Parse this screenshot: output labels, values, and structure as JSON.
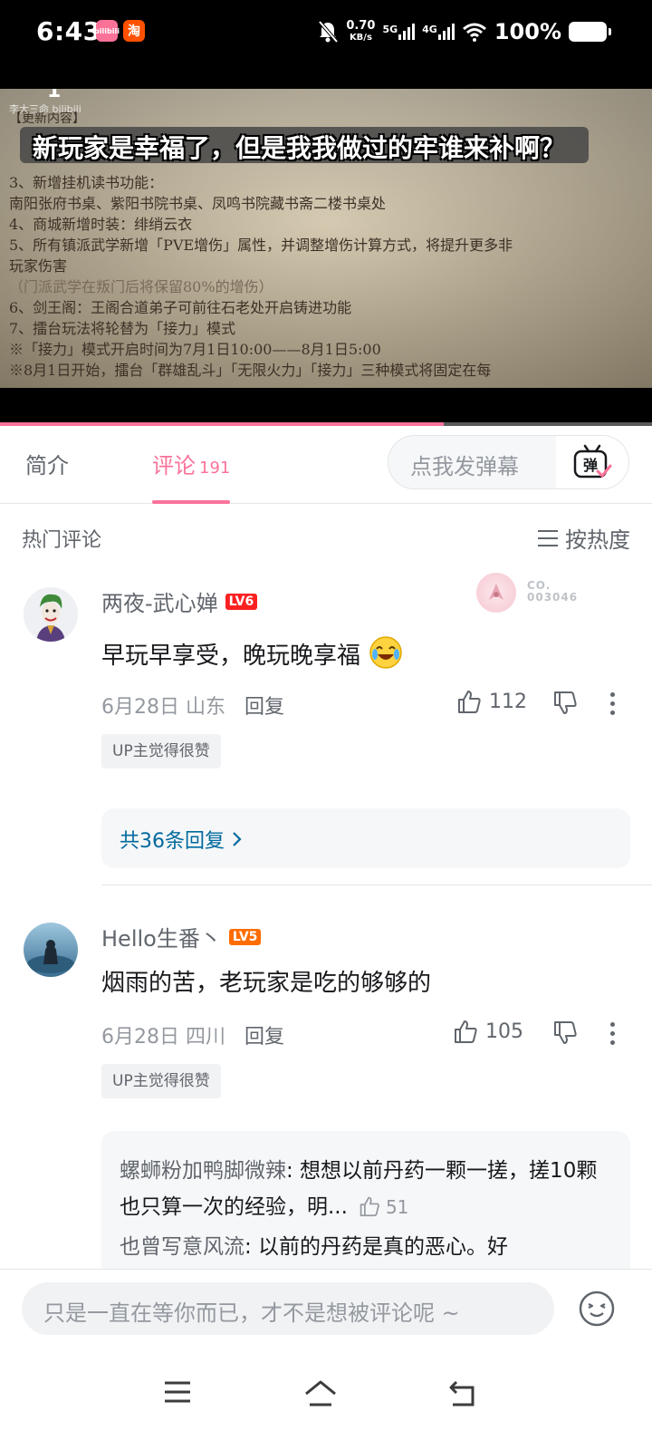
{
  "status_bar": {
    "time": "6:43",
    "app_icon_1": "bilibili",
    "app_icon_1_color": "#fb7299",
    "app_icon_2": "淘",
    "app_icon_2_color": "#ff5000",
    "mute_icon": "bell-off-icon",
    "net_speed_value": "0.70",
    "net_speed_unit": "KB/s",
    "network_1": "5G",
    "network_2": "4G",
    "battery": "100%"
  },
  "video": {
    "episode_num": "1",
    "watermark": "李大三命 bilibili",
    "caption": "新玩家是幸福了，但是我我做过的牢谁来补啊？",
    "header_line": "【更新内容】",
    "lines": [
      "3、新增挂机读书功能：",
      "南阳张府书桌、紫阳书院书桌、凤鸣书院藏书斋二楼书桌处",
      "4、商城新增时装：绯绡云衣",
      "5、所有镇派武学新增「PVE增伤」属性，并调整增伤计算方式，将提升更多非",
      "玩家伤害",
      "（门派武学在叛门后将保留80%的增伤）",
      "6、剑王阁：王阁合道弟子可前往石老处开启铸进功能",
      "7、擂台玩法将轮替为「接力」模式",
      "※「接力」模式开启时间为7月1日10:00——8月1日5:00",
      "※8月1日开始，擂台「群雄乱斗」「无限火力」「接力」三种模式将固定在每"
    ],
    "progress": 0.68
  },
  "tabs": {
    "intro": "简介",
    "comments": "评论",
    "comments_count": "191",
    "danmaku_placeholder": "点我发弹幕",
    "danmaku_button_icon": "danmaku-tv-icon",
    "danmaku_button_label": "弹"
  },
  "hot": {
    "title": "热门评论",
    "sort_label": "按热度",
    "sort_icon": "list-sort-icon"
  },
  "comments": [
    {
      "username": "两夜-武心婵",
      "level": "LV6",
      "level_color": "#fb2121",
      "text": "早玩早享受，晚玩晚享福",
      "emoji": "laughing-cry-emoji-icon",
      "date_location": "6月28日 山东",
      "reply_label": "回复",
      "likes": "112",
      "up_badge": "UP主觉得很赞",
      "fan_badge_num_1": "CO.",
      "fan_badge_num_2": "003046",
      "replies_summary": "共36条回复"
    },
    {
      "username": "Hello生番丶",
      "level": "LV5",
      "level_color": "#ff6c00",
      "text": "烟雨的苦，老玩家是吃的够够的",
      "date_location": "6月28日 四川",
      "reply_label": "回复",
      "likes": "105",
      "up_badge": "UP主觉得很赞",
      "sub_replies": [
        {
          "author": "螺蛳粉加鸭脚微辣",
          "text": " 想想以前丹药一颗一搓，搓10颗也只算一次的经验，明...",
          "likes": "51"
        },
        {
          "author": "也曾写意风流",
          "text": " 以前的丹药是真的恶心。好"
        }
      ]
    }
  ],
  "input_bar": {
    "placeholder": "只是一直在等你而已，才不是想被评论呢 ~",
    "emoji_icon": "emoji-face-icon"
  },
  "navbar": {
    "menu_icon": "menu-icon",
    "home_icon": "home-icon",
    "back_icon": "back-icon"
  },
  "accent_color": "#fb7299"
}
